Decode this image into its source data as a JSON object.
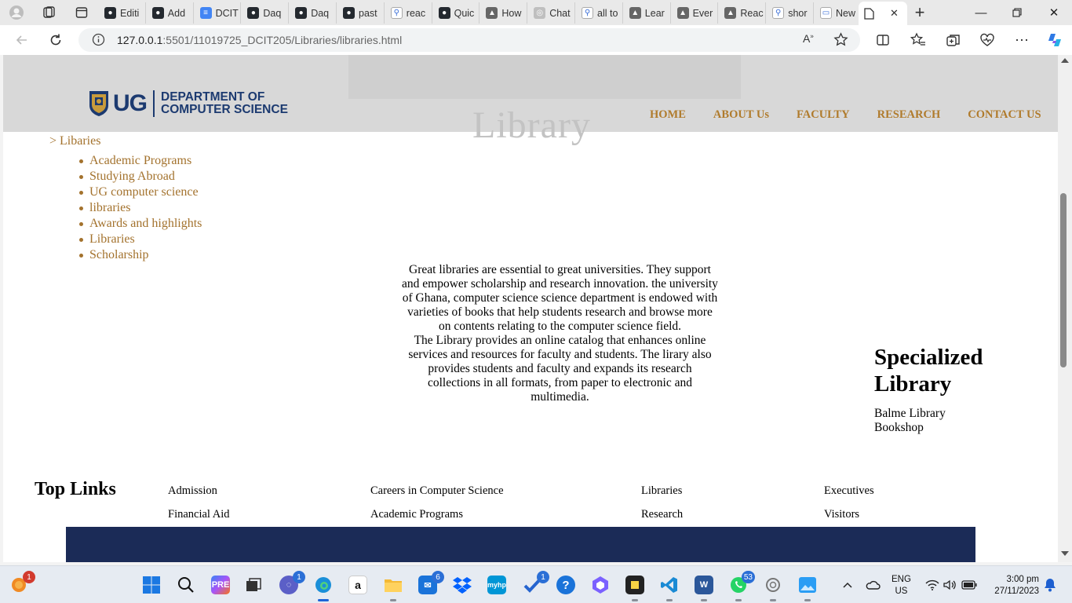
{
  "browser": {
    "tabs": [
      {
        "label": "Editi",
        "icon": "github-icon"
      },
      {
        "label": "Add",
        "icon": "github-icon"
      },
      {
        "label": "DCIT",
        "icon": "docs-icon"
      },
      {
        "label": "Daq",
        "icon": "github-icon"
      },
      {
        "label": "Daq",
        "icon": "github-icon"
      },
      {
        "label": "past",
        "icon": "github-icon"
      },
      {
        "label": "reac",
        "icon": "search-icon"
      },
      {
        "label": "Quic",
        "icon": "github-icon"
      },
      {
        "label": "How",
        "icon": "app-icon"
      },
      {
        "label": "Chat",
        "icon": "chatgpt-icon"
      },
      {
        "label": "all to",
        "icon": "search-icon"
      },
      {
        "label": "Lear",
        "icon": "app-icon"
      },
      {
        "label": "Ever",
        "icon": "app-icon"
      },
      {
        "label": "Reac",
        "icon": "app-icon"
      },
      {
        "label": "shor",
        "icon": "search-icon"
      },
      {
        "label": "New",
        "icon": "newtab-icon"
      }
    ],
    "active_tab_close": "✕",
    "new_tab": "+",
    "url_host": "127.0.0.1",
    "url_path": ":5501/11019725_DCIT205/Libraries/libraries.html"
  },
  "site": {
    "hero_word": "Library",
    "logo": {
      "ug": "UG",
      "dept_line1": "DEPARTMENT OF",
      "dept_line2": "COMPUTER SCIENCE"
    },
    "nav": [
      "HOME",
      "ABOUT Us",
      "FACULTY",
      "RESEARCH",
      "CONTACT US"
    ],
    "breadcrumb": "> Libaries",
    "side_links": [
      "Academic Programs",
      "Studying Abroad",
      "UG computer science",
      "libraries",
      "Awards and highlights",
      "Libraries",
      "Scholarship"
    ],
    "intro_p1": "Great libraries are essential to great universities. They support and empower scholarship and research innovation. the university of Ghana, computer science science department is endowed with varieties of books that help students research and browse more on contents relating to the computer science field.",
    "intro_p2": "The Library provides an online catalog that enhances online services and resources for faculty and students. The lirary also provides students and faculty and expands its research collections in all formats, from paper to electronic and multimedia.",
    "specialized": {
      "title": "Specialized Library",
      "items": [
        "Balme Library",
        "Bookshop"
      ]
    },
    "top_links": {
      "title": "Top Links",
      "row1": [
        "Admission",
        "Careers in Computer Science",
        "Libraries",
        "Executives"
      ],
      "row2": [
        "Financial Aid",
        "Academic Programs",
        "Research",
        "Visitors"
      ]
    }
  },
  "taskbar": {
    "weather_badge": "1",
    "teams_badge": "1",
    "mail_badge": "6",
    "whatsapp_badge": "53",
    "lang": {
      "line1": "ENG",
      "line2": "US"
    },
    "time": "3:00 pm",
    "date": "27/11/2023"
  },
  "colors": {
    "accent_gold": "#a3722d",
    "brand_navy": "#1b2b57"
  }
}
